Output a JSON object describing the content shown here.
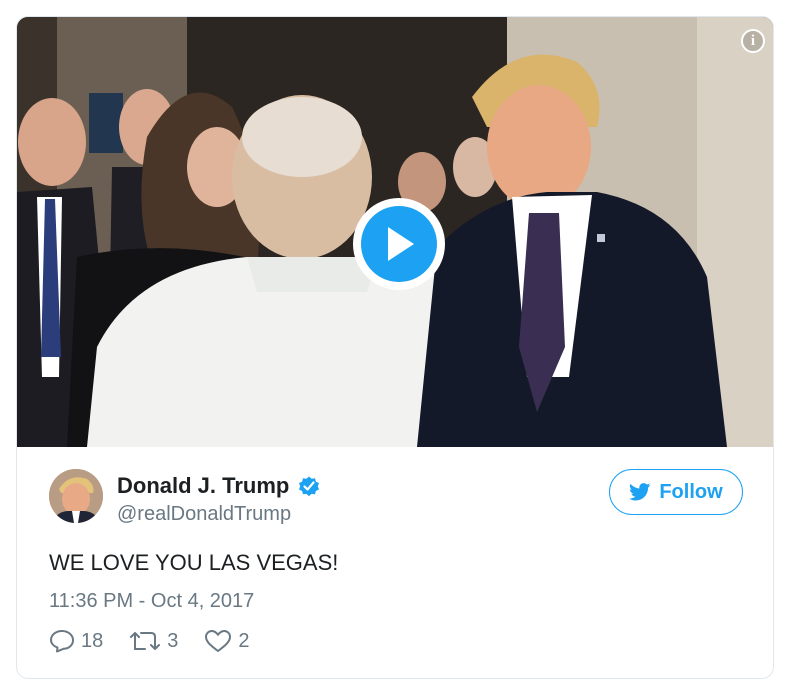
{
  "media": {
    "info_icon": "info-icon",
    "play_icon": "play-icon",
    "accent_color": "#1da1f2"
  },
  "author": {
    "name": "Donald J. Trump",
    "handle": "@realDonaldTrump",
    "verified": true,
    "avatar_icon": "avatar"
  },
  "follow": {
    "label": "Follow",
    "icon": "twitter-bird-icon"
  },
  "tweet": {
    "text": "WE LOVE YOU LAS VEGAS!",
    "timestamp": "11:36 PM - Oct 4, 2017"
  },
  "actions": {
    "replies": "18",
    "retweets": "3",
    "likes": "2"
  }
}
